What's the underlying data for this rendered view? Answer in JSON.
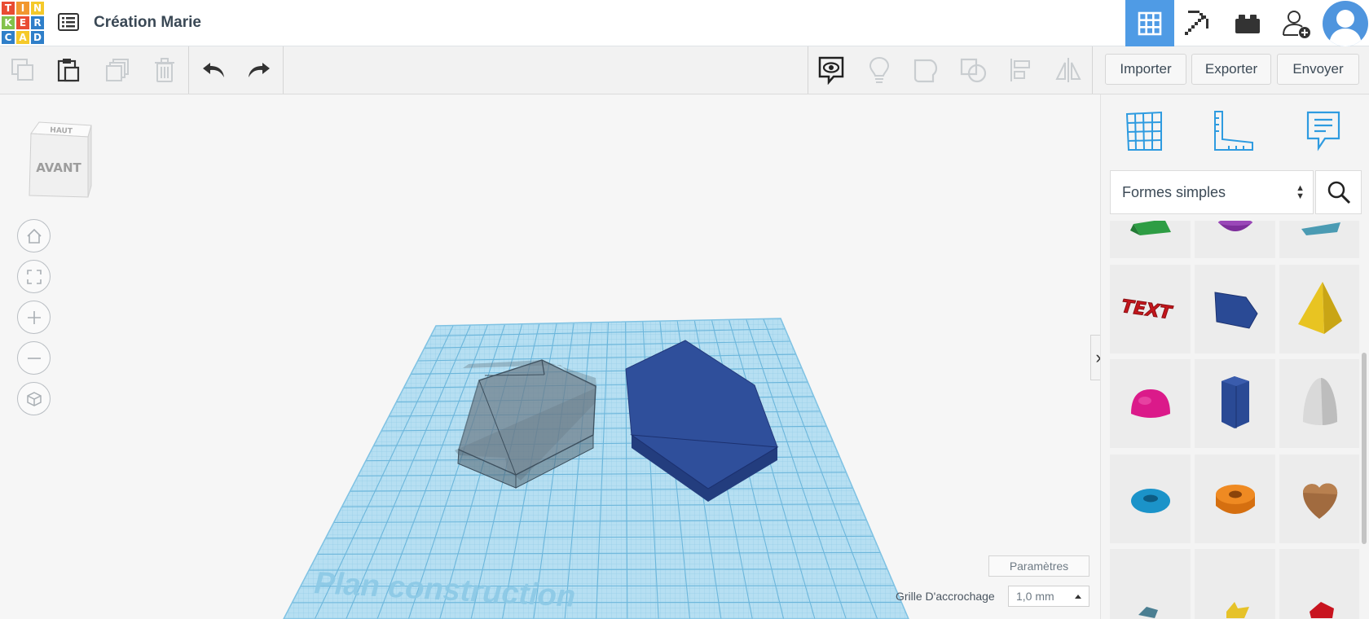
{
  "app": {
    "logo_letters": [
      "T",
      "I",
      "N",
      "K",
      "E",
      "R",
      "C",
      "A",
      "D"
    ],
    "logo_colors": [
      "#e94c33",
      "#f2972f",
      "#f5c92a",
      "#83c24b",
      "#e94c33",
      "#2f7fc9",
      "#2f7fc9",
      "#f5c92a",
      "#2f7fc9"
    ],
    "design_title": "Création Marie"
  },
  "topnav": {
    "items": [
      "grid-3d-icon",
      "pickaxe-icon",
      "brick-icon",
      "add-user-icon",
      "avatar"
    ],
    "active_color": "#4f9be5"
  },
  "toolbar": {
    "left_icons": [
      "copy-icon",
      "paste-icon",
      "duplicate-icon",
      "delete-icon",
      "undo-icon",
      "redo-icon"
    ],
    "right_icons": [
      "notes-eye-icon",
      "lightbulb-icon",
      "group-icon",
      "ungroup-icon",
      "align-icon",
      "mirror-icon"
    ],
    "import_label": "Importer",
    "export_label": "Exporter",
    "send_label": "Envoyer"
  },
  "viewcube": {
    "top_label": "HAUT",
    "front_label": "AVANT"
  },
  "workplane": {
    "watermark": "Plan construction",
    "plane_color": "#a9d8ef",
    "hole_shape_color": "#6e7e8a",
    "solid_shape_color": "#2f4f99"
  },
  "bottom": {
    "params_label": "Paramètres",
    "snap_label": "Grille D'accrochage",
    "snap_value": "1,0 mm"
  },
  "panel": {
    "icons": [
      "workplane-grid-icon",
      "ruler-icon",
      "notes-icon"
    ],
    "library_select": "Formes simples",
    "shapes": [
      "wedge-green",
      "half-sphere-purple",
      "roof-teal",
      "text-red",
      "polygon-blue",
      "pyramid-yellow",
      "half-sphere-pink",
      "hexagonal-prism-blue",
      "paraboloid-white",
      "torus-blue",
      "tube-orange",
      "heart-brown",
      "star-teal",
      "star-yellow",
      "polyhedron-red"
    ],
    "text_shape_label": "TEXT"
  }
}
